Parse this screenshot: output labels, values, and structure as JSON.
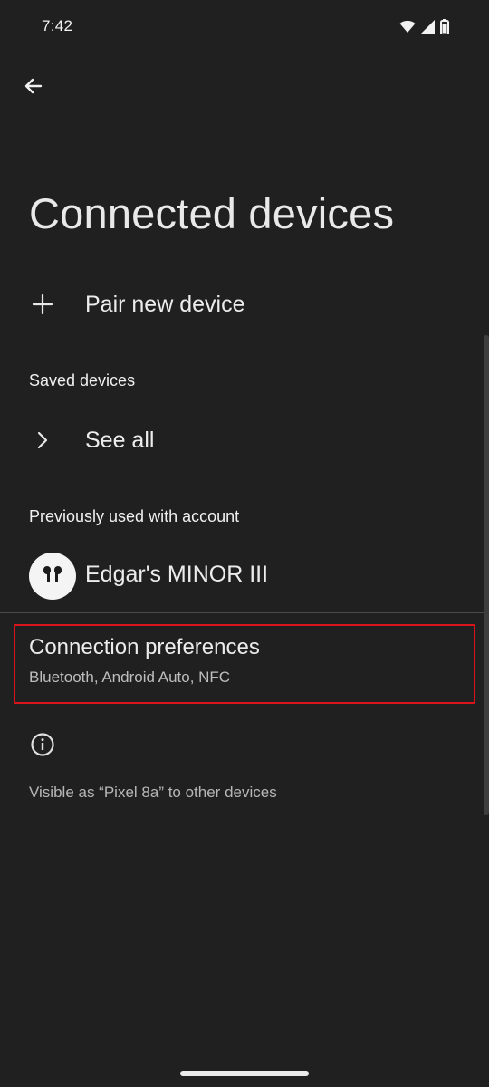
{
  "status_bar": {
    "time": "7:42",
    "icons": [
      "wifi-icon",
      "signal-icon",
      "battery-icon"
    ]
  },
  "header": {
    "back_icon": "arrow-back-icon",
    "title": "Connected devices"
  },
  "pair": {
    "icon": "plus-icon",
    "label": "Pair new device"
  },
  "saved_devices": {
    "header": "Saved devices",
    "see_all_icon": "chevron-right-icon",
    "see_all_label": "See all"
  },
  "previously_used": {
    "header": "Previously used with account",
    "device_icon": "earbuds-icon",
    "device_name": "Edgar's MINOR III"
  },
  "connection_preferences": {
    "title": "Connection preferences",
    "subtitle": "Bluetooth, Android Auto, NFC"
  },
  "footer": {
    "info_icon": "info-icon",
    "text": "Visible as “Pixel 8a” to other devices"
  },
  "colors": {
    "background": "#202020",
    "highlight_border": "#d9141b",
    "text_primary": "#ececec",
    "text_secondary": "#bdbdbd"
  }
}
